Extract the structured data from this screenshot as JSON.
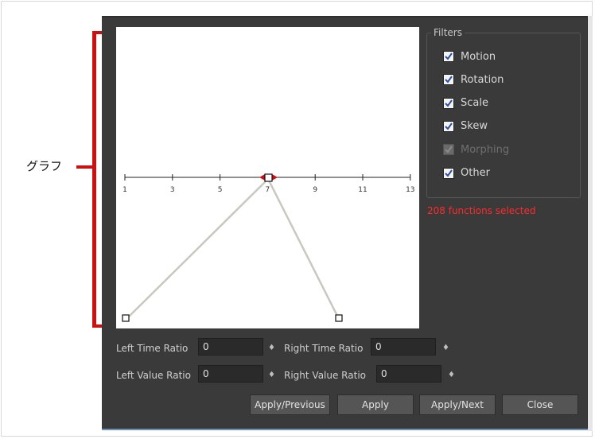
{
  "annotation": {
    "label": "グラフ"
  },
  "graph": {
    "tick_labels": [
      "1",
      "3",
      "5",
      "7",
      "9",
      "11",
      "13"
    ]
  },
  "filters": {
    "title": "Filters",
    "items": [
      {
        "label": "Motion",
        "checked": true,
        "enabled": true
      },
      {
        "label": "Rotation",
        "checked": true,
        "enabled": true
      },
      {
        "label": "Scale",
        "checked": true,
        "enabled": true
      },
      {
        "label": "Skew",
        "checked": true,
        "enabled": true
      },
      {
        "label": "Morphing",
        "checked": true,
        "enabled": false
      },
      {
        "label": "Other",
        "checked": true,
        "enabled": true
      }
    ]
  },
  "status": {
    "text": "208 functions selected",
    "color": "#ff2a2a"
  },
  "ratios": {
    "left_time_label": "Left Time Ratio",
    "left_time_value": "0",
    "right_time_label": "Right Time Ratio",
    "right_time_value": "0",
    "left_value_label": "Left Value Ratio",
    "left_value_value": "0",
    "right_value_label": "Right Value Ratio",
    "right_value_value": "0",
    "spin_glyph": "♦"
  },
  "buttons": {
    "apply_previous": "Apply/Previous",
    "apply": "Apply",
    "apply_next": "Apply/Next",
    "close": "Close"
  },
  "colors": {
    "annotation": "#cc1111",
    "dialog_bg": "#3a3a3a",
    "graph_bg": "#ffffff",
    "curve": "#c8c8c0"
  }
}
